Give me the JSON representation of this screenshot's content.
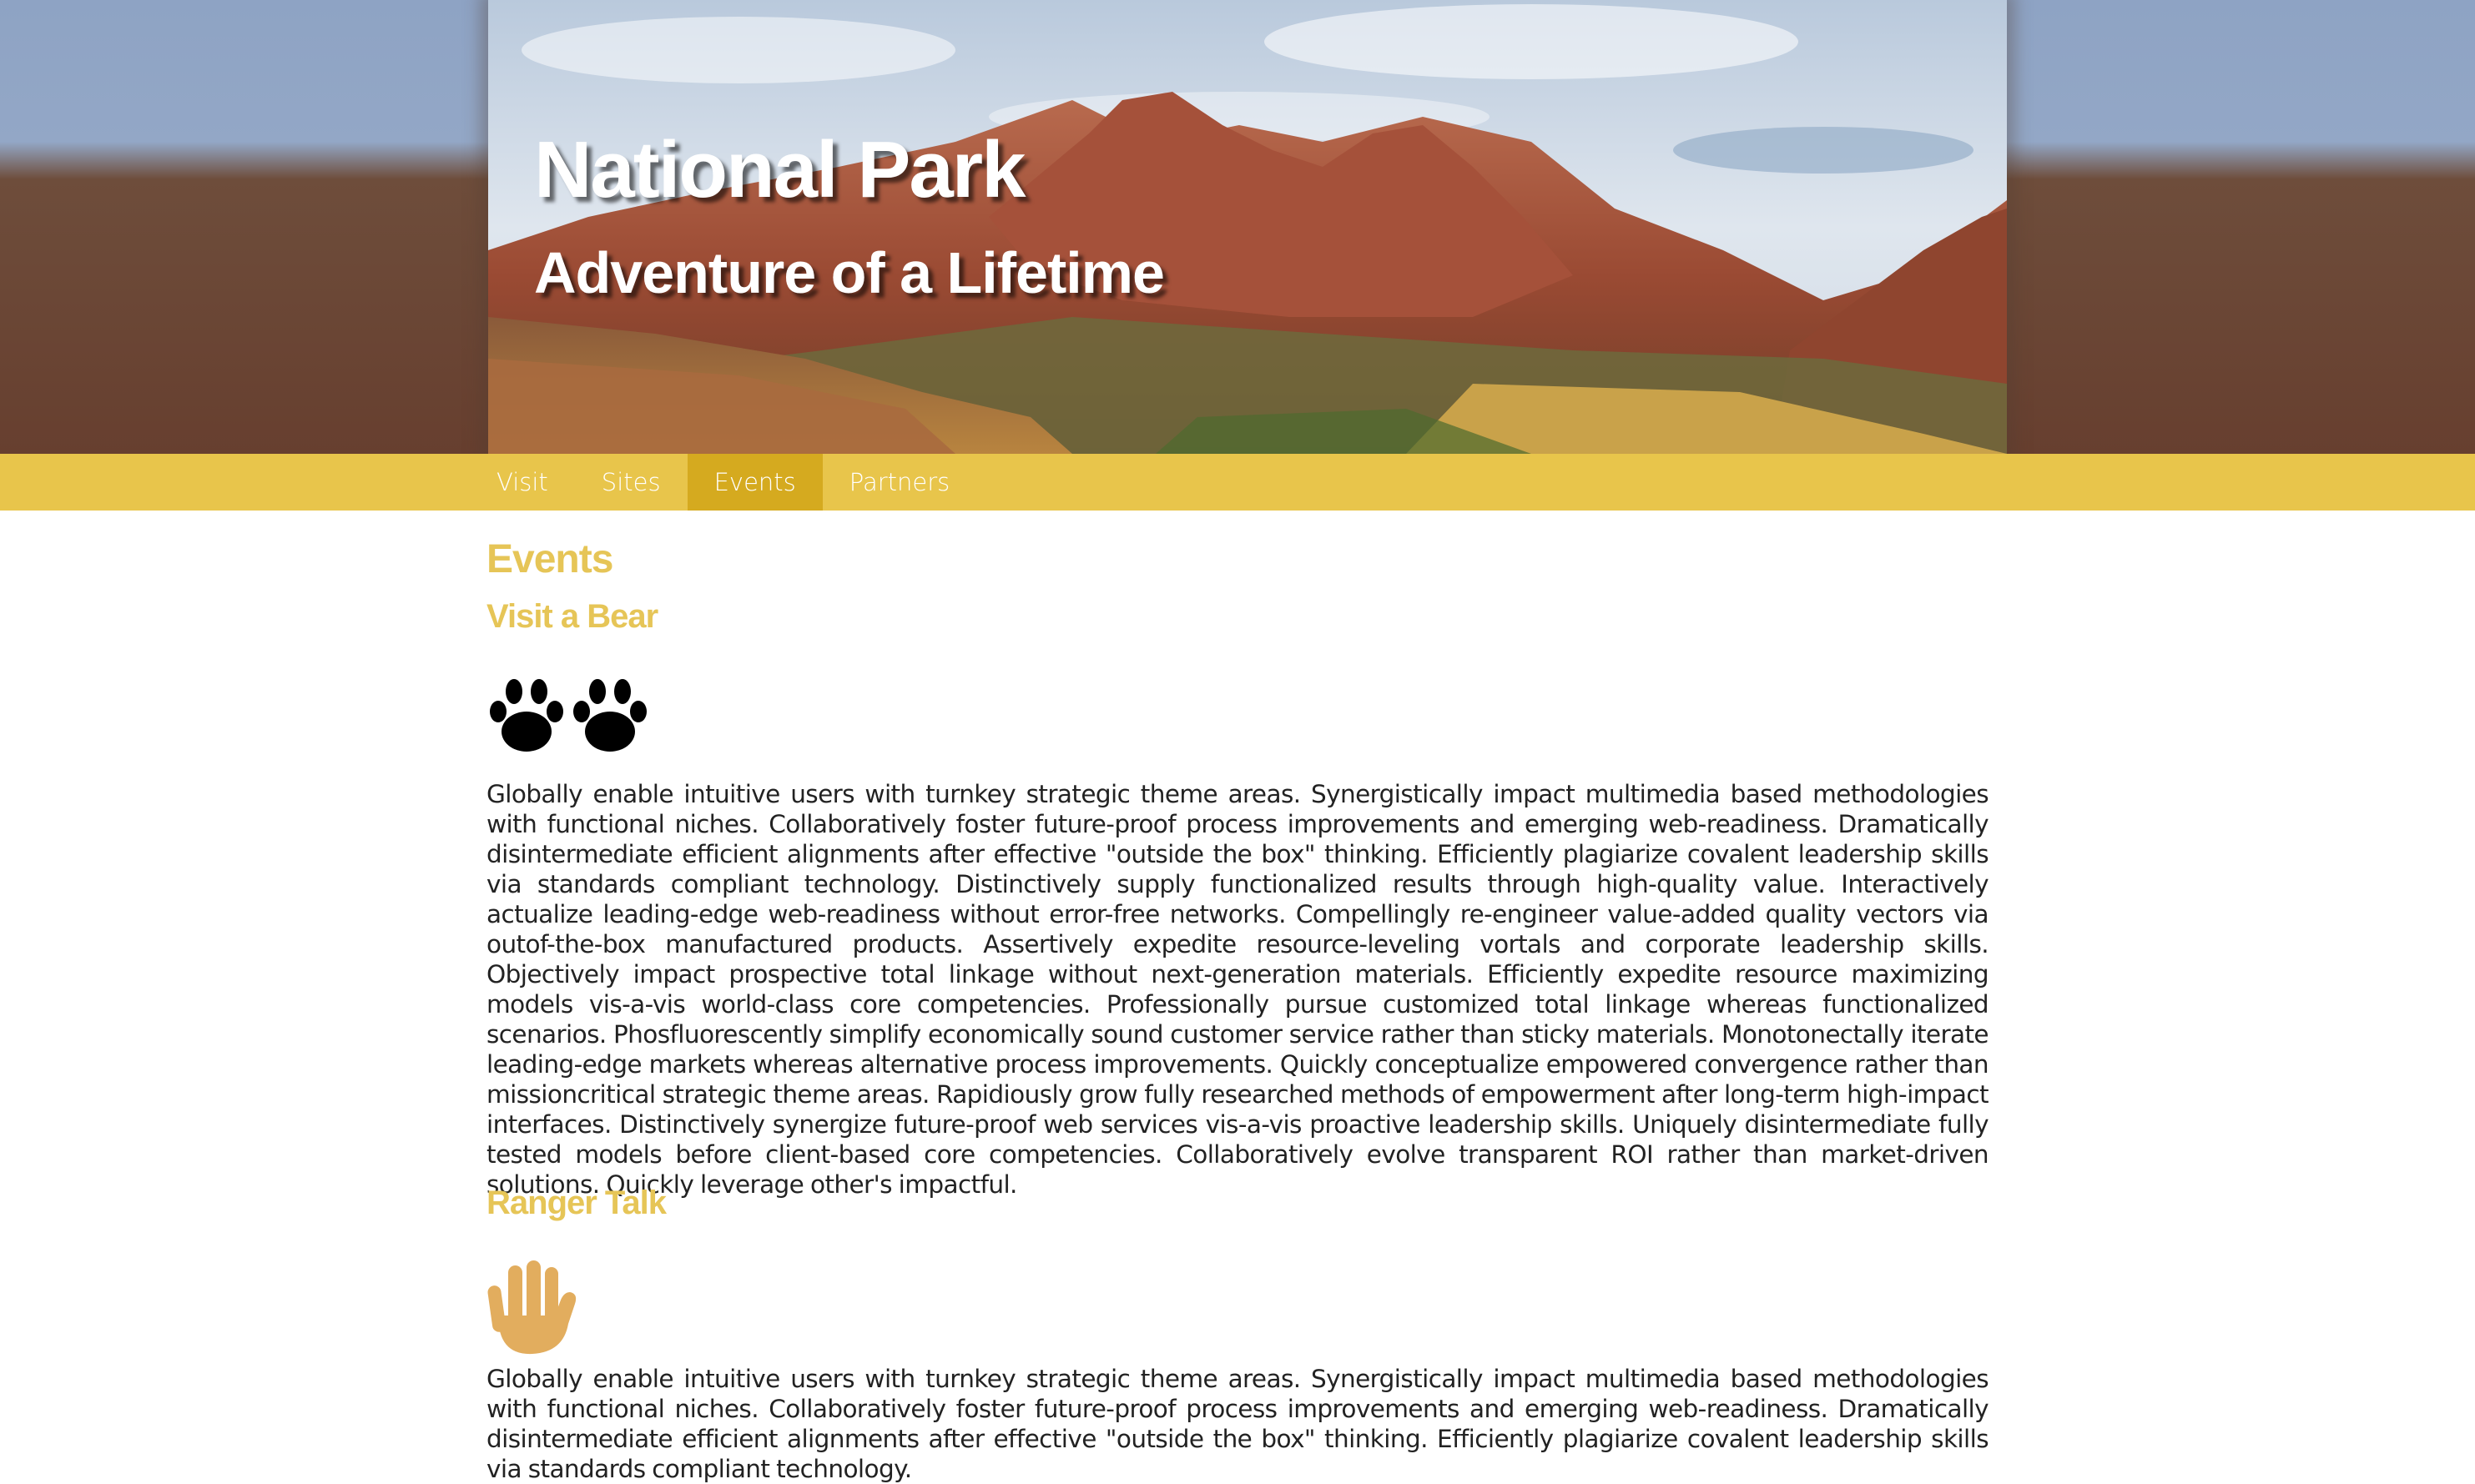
{
  "hero": {
    "title": "National Park",
    "subtitle": "Adventure of a Lifetime"
  },
  "nav": {
    "items": [
      {
        "label": "Visit",
        "active": false
      },
      {
        "label": "Sites",
        "active": false
      },
      {
        "label": "Events",
        "active": true
      },
      {
        "label": "Partners",
        "active": false
      }
    ]
  },
  "main": {
    "heading": "Events",
    "events": [
      {
        "title": "Visit a Bear",
        "icon": "paw-prints-icon",
        "body": "Globally enable intuitive users with turnkey strategic theme areas. Synergistically impact multimedia based methodologies with functional niches. Collaboratively foster future-proof process improvements and emerging web-readiness. Dramatically disintermediate efficient alignments after effective \"outside the box\" thinking. Efficiently plagiarize covalent leadership skills via standards compliant technology. Distinctively supply functionalized results through high-quality value. Interactively actualize leading-edge web-readiness without error-free networks. Compellingly re-engineer value-added quality vectors via outof-the-box manufactured products. Assertively expedite resource-leveling vortals and corporate leadership skills. Objectively impact prospective total linkage without next-generation materials. Efficiently expedite resource maximizing models vis-a-vis world-class core competencies. Professionally pursue customized total linkage whereas functionalized scenarios. Phosfluorescently simplify economically sound customer service rather than sticky materials. Monotonectally iterate leading-edge markets whereas alternative process improvements. Quickly conceptualize empowered convergence rather than missioncritical strategic theme areas. Rapidiously grow fully researched methods of empowerment after long-term high-impact interfaces. Distinctively synergize future-proof web services vis-a-vis proactive leadership skills. Uniquely disintermediate fully tested models before client-based core competencies. Collaboratively evolve transparent ROI rather than market-driven solutions. Quickly leverage other's impactful."
      },
      {
        "title": "Ranger Talk",
        "icon": "raised-hand-icon",
        "body": "Globally enable intuitive users with turnkey strategic theme areas. Synergistically impact multimedia based methodologies with functional niches. Collaboratively foster future-proof process improvements and emerging web-readiness. Dramatically disintermediate efficient alignments after effective \"outside the box\" thinking. Efficiently plagiarize covalent leadership skills via standards compliant technology."
      }
    ]
  },
  "colors": {
    "nav_bg": "#e8c54b",
    "nav_active": "#d5aa1f",
    "heading": "#e6c557",
    "hand": "#e2ad5e"
  }
}
